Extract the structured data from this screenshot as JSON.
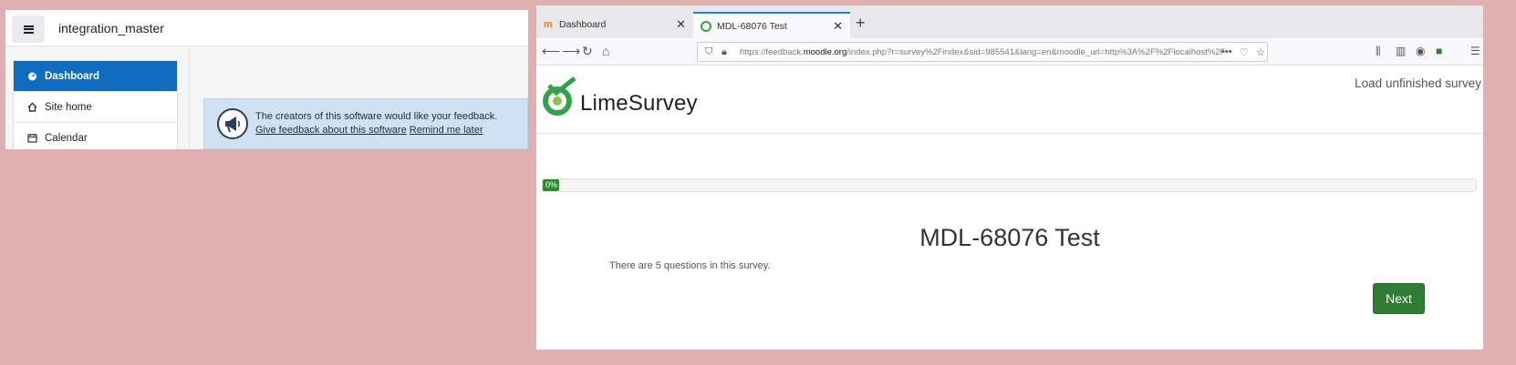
{
  "moodle": {
    "site_name": "integration_master",
    "nav": [
      {
        "label": "Dashboard",
        "icon": "dashboard-icon",
        "active": true
      },
      {
        "label": "Site home",
        "icon": "home-icon",
        "active": false
      },
      {
        "label": "Calendar",
        "icon": "calendar-icon",
        "active": false
      }
    ],
    "feedback": {
      "message": "The creators of this software would like your feedback.",
      "give_feedback_link": "Give feedback about this software",
      "remind_link": "Remind me later",
      "icon": "megaphone-icon"
    }
  },
  "browser": {
    "tabs": [
      {
        "title": "Dashboard",
        "active": false
      },
      {
        "title": "MDL-68076 Test",
        "active": true
      }
    ],
    "url": {
      "prefix": "https://feedback.",
      "host": "moodle.org",
      "rest": "/index.php?r=survey%2Findex&sid=985541&lang=en&moodle_url=http%3A%2F%2Flocalhost%2F"
    }
  },
  "survey": {
    "logo_text": "LimeSurvey",
    "load_unfinished": "Load unfinished survey",
    "progress_label": "0%",
    "progress_value": 0,
    "title": "MDL-68076 Test",
    "description": "There are 5 questions in this survey.",
    "next_label": "Next"
  },
  "colors": {
    "moodle_blue": "#0f6cbf",
    "lime_green": "#2e7d32",
    "background": "#e0afaf"
  }
}
